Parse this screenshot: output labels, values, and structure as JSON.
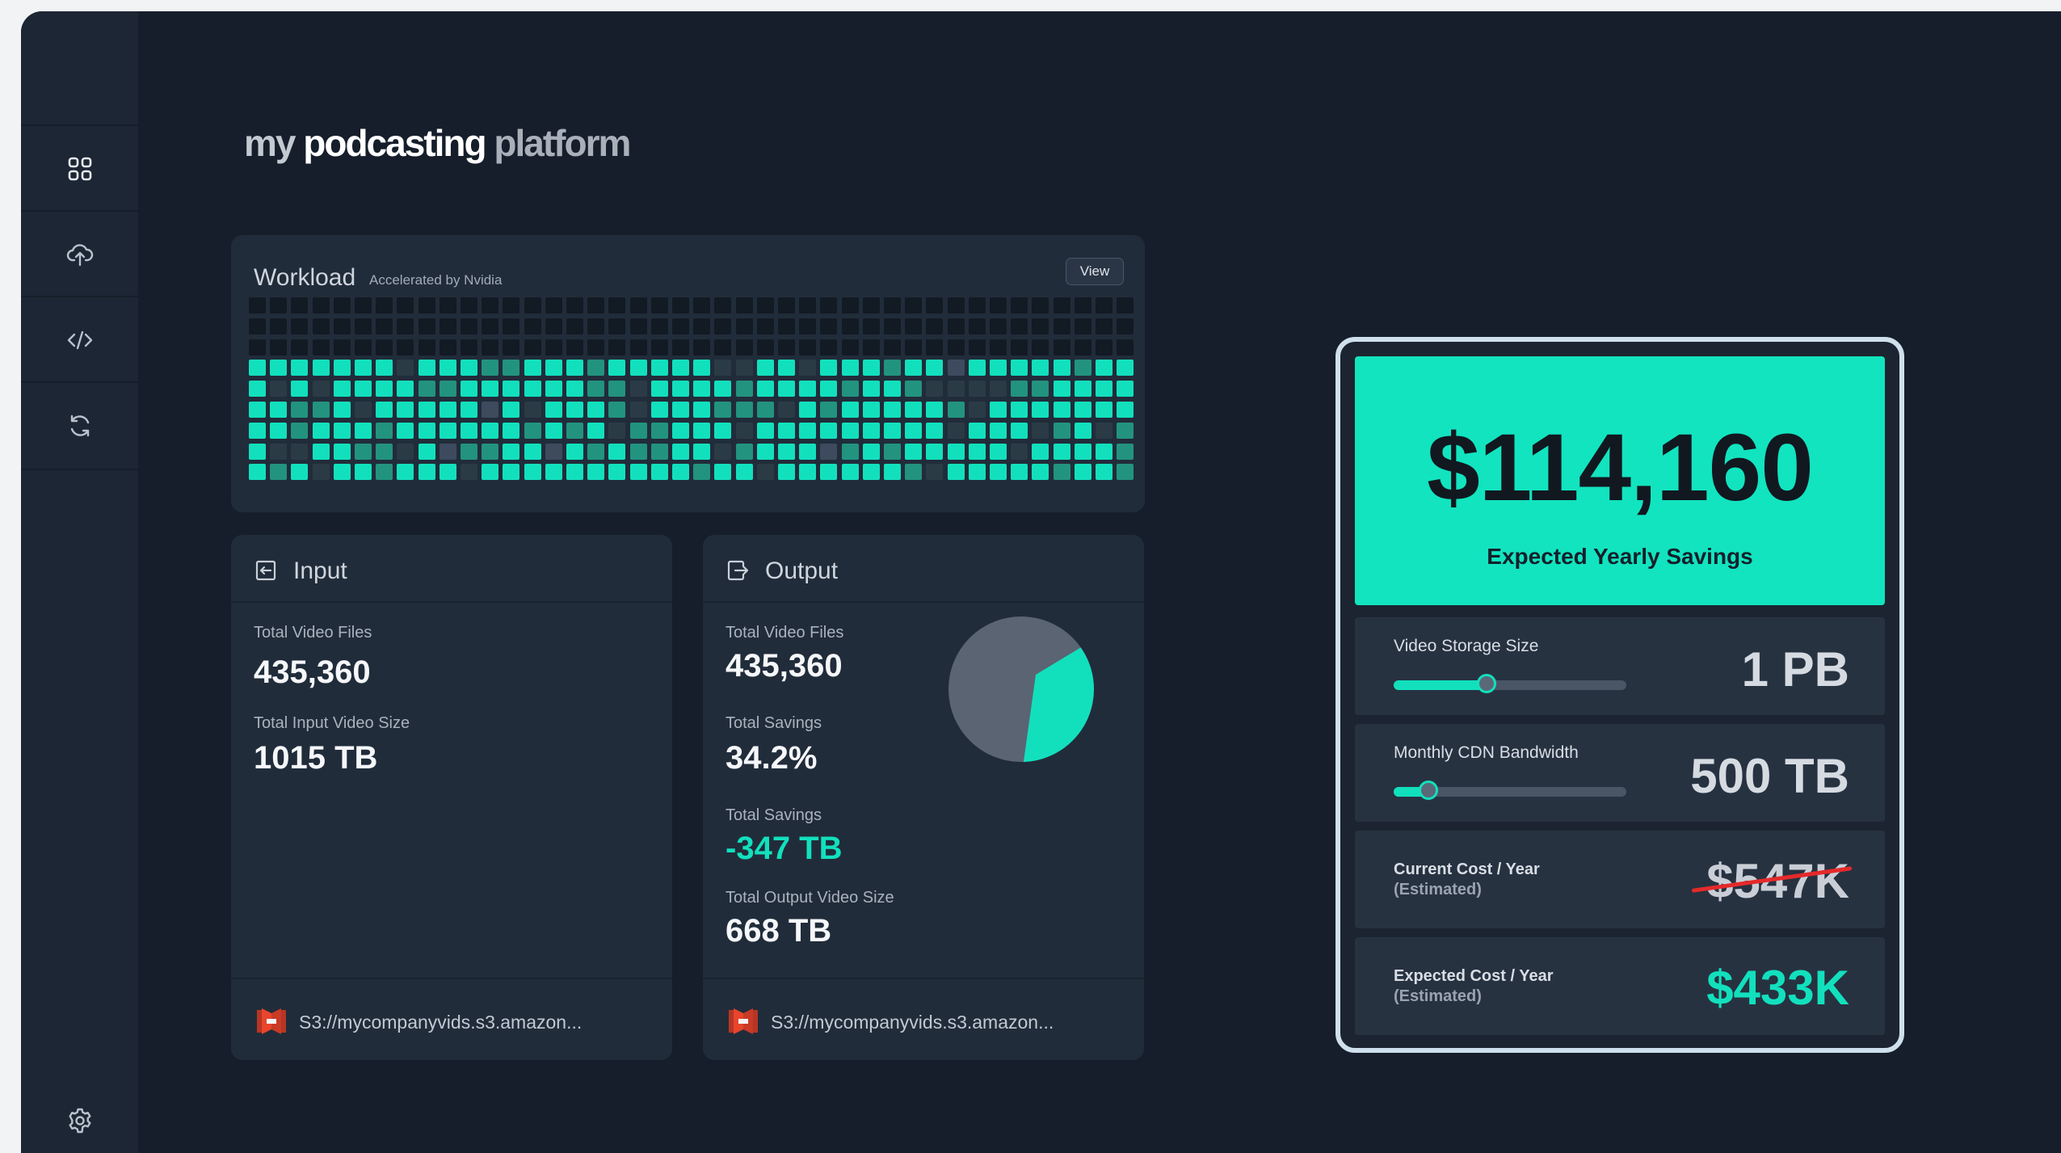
{
  "app": {
    "brand": {
      "part1": "my",
      "part2": "podcasting",
      "part3": "platform"
    }
  },
  "sidebar": {
    "items": [
      {
        "icon": "dashboard-grid-icon"
      },
      {
        "icon": "cloud-upload-icon"
      },
      {
        "icon": "code-icon"
      },
      {
        "icon": "sync-icon"
      }
    ],
    "settings_icon": "gear-icon"
  },
  "workload": {
    "title": "Workload",
    "subtitle": "Accelerated by Nvidia",
    "view_label": "View",
    "grid": {
      "columns": 42,
      "rows": 9,
      "empty_rows": 3
    },
    "colors": {
      "empty": "#121a24",
      "dark": "#2b3b46",
      "mid": "#22937f",
      "bright": "#12e0bd",
      "highlight": "#1de9c6",
      "muted": "#3e4a5e"
    }
  },
  "input": {
    "title": "Input",
    "total_files_label": "Total Video Files",
    "total_files_value": "435,360",
    "size_label": "Total Input Video Size",
    "size_value": "1015 TB",
    "source_path": "S3://mycompanyvids.s3.amazon..."
  },
  "output": {
    "title": "Output",
    "total_files_label": "Total Video Files",
    "total_files_value": "435,360",
    "savings_pct_label": "Total Savings",
    "savings_pct_value": "34.2%",
    "savings_tb_label": "Total Savings",
    "savings_tb_value": "-347 TB",
    "size_label": "Total Output Video Size",
    "size_value": "668 TB",
    "source_path": "S3://mycompanyvids.s3.amazon...",
    "pie_savings_fraction": 0.342
  },
  "savings": {
    "amount": "$114,160",
    "caption": "Expected Yearly Savings",
    "storage": {
      "label": "Video Storage Size",
      "value": "1 PB",
      "slider_fraction": 0.4
    },
    "cdn": {
      "label": "Monthly CDN Bandwidth",
      "value": "500 TB",
      "slider_fraction": 0.15
    },
    "current_cost": {
      "label": "Current Cost / Year",
      "sub": "(Estimated)",
      "value": "$547K"
    },
    "expected_cost": {
      "label": "Expected Cost / Year",
      "sub": "(Estimated)",
      "value": "$433K"
    }
  },
  "colors": {
    "accent": "#12e0bd",
    "background": "#151e2a",
    "card": "#212c3a",
    "strike": "#e42a2a",
    "s3_icon": "#e8452c"
  }
}
